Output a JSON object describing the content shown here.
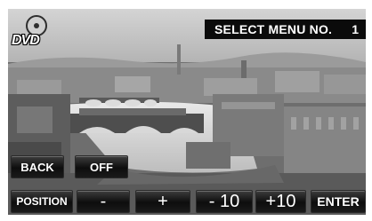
{
  "header": {
    "title": "SELECT MENU NO.",
    "menu_number": "1"
  },
  "logo": {
    "text": "DVD",
    "icon": "dvd-disc-icon"
  },
  "buttons": {
    "back": "BACK",
    "off": "OFF",
    "position": "POSITION",
    "minus": "-",
    "plus": "+",
    "minus_ten": "- 10",
    "plus_ten": "+10",
    "enter": "ENTER"
  },
  "colors": {
    "status_bar": "#0b0b0b",
    "button_face": "#121212",
    "button_text": "#ffffff"
  }
}
